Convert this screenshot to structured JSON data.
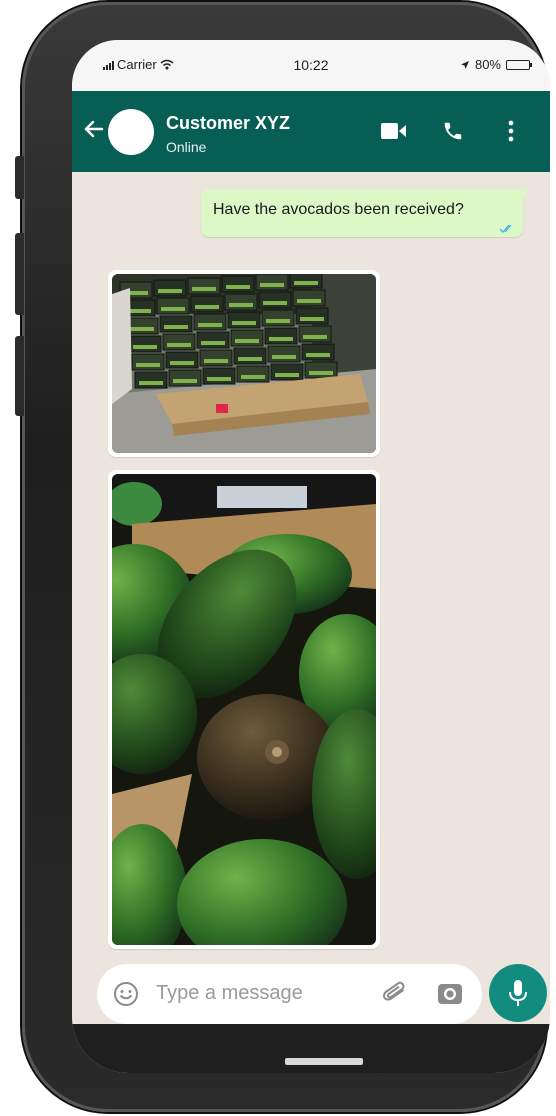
{
  "status_bar": {
    "carrier": "Carrier",
    "time": "10:22",
    "battery": "80%",
    "battery_level": 0.8
  },
  "header": {
    "contact_name": "Customer XYZ",
    "contact_status": "Online",
    "color": "#075e54",
    "icons": [
      "back-arrow-icon",
      "video-call-icon",
      "phone-call-icon",
      "more-options-icon"
    ]
  },
  "messages": [
    {
      "type": "text",
      "direction": "outgoing",
      "text": "Have the avocados been received?",
      "status": "read"
    },
    {
      "type": "image",
      "direction": "incoming",
      "subject": "pallet-of-avocado-boxes"
    },
    {
      "type": "image",
      "direction": "incoming",
      "subject": "box-of-avocados"
    }
  ],
  "composer": {
    "placeholder": "Type a message",
    "icons": [
      "emoji-icon",
      "attachment-icon",
      "camera-icon",
      "microphone-icon"
    ],
    "accent": "#128c7e"
  },
  "colors": {
    "chat_background": "#ece5dd",
    "outgoing_bubble": "#dcf8c6",
    "read_ticks": "#34b7f1"
  }
}
